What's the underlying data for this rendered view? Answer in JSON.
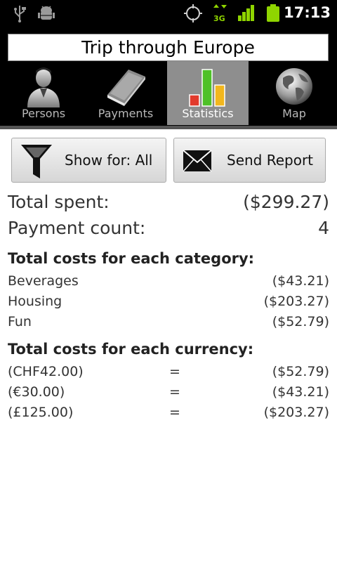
{
  "status_bar": {
    "time": "17:13",
    "icons": [
      "usb-icon",
      "android-debug-icon",
      "gps-icon",
      "3g-data-icon",
      "signal-icon",
      "battery-icon"
    ],
    "network_label": "3G"
  },
  "header": {
    "trip_title": "Trip through Europe",
    "tabs": [
      {
        "label": "Persons",
        "icon": "person-icon"
      },
      {
        "label": "Payments",
        "icon": "book-icon"
      },
      {
        "label": "Statistics",
        "icon": "bar-chart-icon",
        "active": true
      },
      {
        "label": "Map",
        "icon": "globe-icon"
      }
    ]
  },
  "toolbar": {
    "filter_label": "Show for: All",
    "report_label": "Send Report"
  },
  "summary": {
    "total_spent_label": "Total spent:",
    "total_spent_value": "($299.27)",
    "payment_count_label": "Payment count:",
    "payment_count_value": "4"
  },
  "categories": {
    "heading": "Total costs for each category:",
    "items": [
      {
        "name": "Beverages",
        "value": "($43.21)"
      },
      {
        "name": "Housing",
        "value": "($203.27)"
      },
      {
        "name": "Fun",
        "value": "($52.79)"
      }
    ]
  },
  "currencies": {
    "heading": "Total costs for each currency:",
    "items": [
      {
        "original": "(CHF42.00)",
        "equals": "=",
        "value": "($52.79)"
      },
      {
        "original": "(€30.00)",
        "equals": "=",
        "value": "($43.21)"
      },
      {
        "original": "(£125.00)",
        "equals": "=",
        "value": "($203.27)"
      }
    ]
  },
  "colors": {
    "active_tab": "#8e8e8e",
    "header_bg": "#000000",
    "battery": "#8fd400"
  }
}
